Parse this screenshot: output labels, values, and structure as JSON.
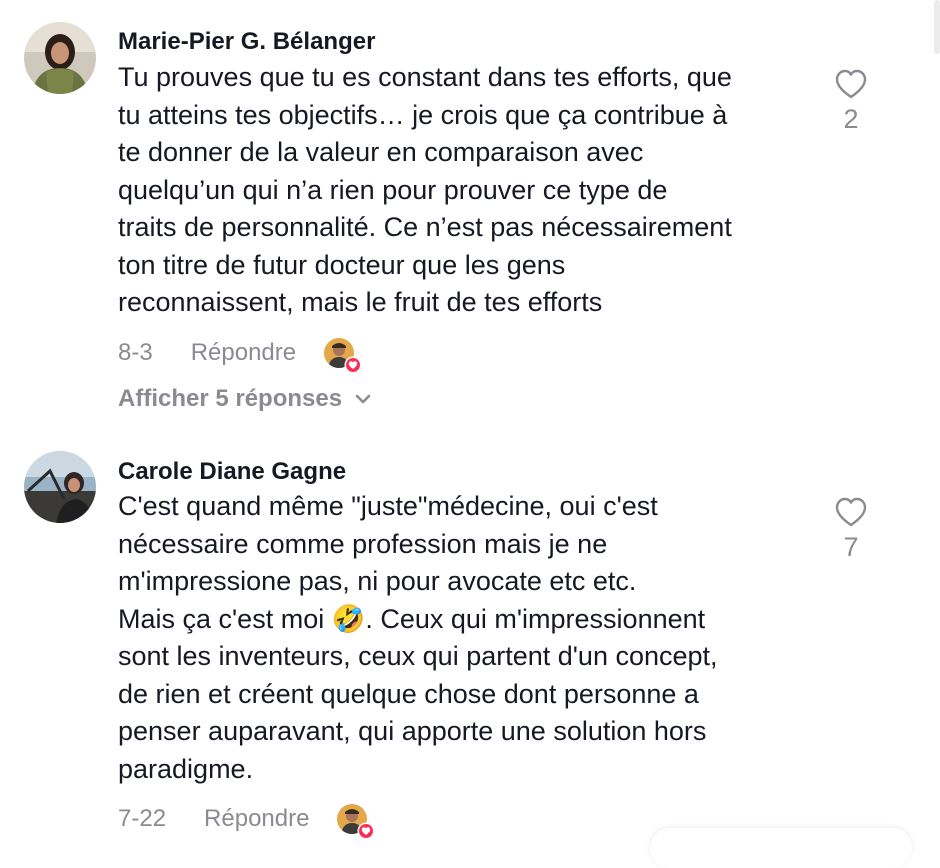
{
  "comments": [
    {
      "author": "Marie-Pier G. Bélanger",
      "lines": [
        "Tu prouves que tu es constant dans tes efforts, que",
        "tu atteins tes objectifs… je crois que ça contribue à",
        "te donner de la valeur en comparaison avec",
        "quelqu’un qui n’a rien pour prouver ce type de",
        "traits de personnalité. Ce n’est pas nécessairement",
        "ton titre de futur docteur que les gens",
        "reconnaissent, mais le fruit de tes efforts"
      ],
      "likes": "2",
      "date": "8-3",
      "reply_label": "Répondre",
      "view_replies_label": "Afficher 5 réponses"
    },
    {
      "author": "Carole Diane Gagne",
      "lines": [
        "C'est quand même \"juste\"médecine, oui c'est",
        "nécessaire comme profession mais je ne",
        "m'impressione pas, ni pour avocate etc etc.",
        "Mais ça c'est moi 🤣. Ceux qui m'impressionnent",
        "sont les inventeurs, ceux qui partent d'un concept,",
        "de rien et créent quelque chose dont personne a",
        "penser auparavant, qui apporte une solution hors",
        "paradigme."
      ],
      "likes": "7",
      "date": "7-22",
      "reply_label": "Répondre"
    }
  ],
  "icons": {
    "like": "heart-outline-icon",
    "expand": "chevron-down-icon",
    "creator_like_badge": "red-heart-badge-icon"
  },
  "colors": {
    "text": "#161823",
    "muted": "#8a8b91",
    "badge": "#fe2c55"
  }
}
